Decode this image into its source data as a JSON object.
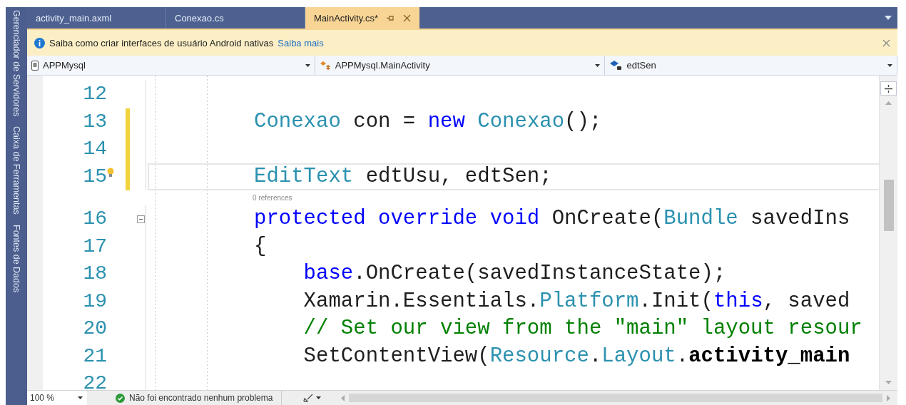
{
  "side_panels": [
    {
      "label": "Gerenciador de Servidores"
    },
    {
      "label": "Caixa de Ferramentas"
    },
    {
      "label": "Fontes de Dados"
    }
  ],
  "tabs": [
    {
      "label": "activity_main.axml",
      "selected": false
    },
    {
      "label": "Conexao.cs",
      "selected": false
    },
    {
      "label": "MainActivity.cs*",
      "selected": true
    }
  ],
  "info_bar": {
    "message": "Saiba como criar interfaces de usuário Android nativas",
    "link": "Saiba mais"
  },
  "nav_bar": {
    "project": "APPMysql",
    "class": "APPMysql.MainActivity",
    "member": "edtSen"
  },
  "editor": {
    "lines": [
      {
        "number": "12",
        "changed": false,
        "current": false,
        "lightbulb": false,
        "foldable": false
      },
      {
        "number": "13",
        "changed": true,
        "current": false,
        "lightbulb": false,
        "foldable": false,
        "tokens": [
          {
            "text": "Conexao",
            "kind": "type"
          },
          {
            "text": " con = ",
            "kind": "plain"
          },
          {
            "text": "new",
            "kind": "keyword"
          },
          {
            "text": " Conexao",
            "kind": "type"
          },
          {
            "text": "();",
            "kind": "plain"
          }
        ]
      },
      {
        "number": "14",
        "changed": true,
        "current": false,
        "lightbulb": false,
        "foldable": false
      },
      {
        "number": "15",
        "changed": true,
        "current": true,
        "lightbulb": true,
        "foldable": false,
        "tokens": [
          {
            "text": "EditText",
            "kind": "type"
          },
          {
            "text": " edtUsu, edtSen;",
            "kind": "plain"
          }
        ]
      },
      {
        "number": "16",
        "changed": false,
        "current": false,
        "lightbulb": false,
        "foldable": true,
        "codelens": "0 references",
        "tokens": [
          {
            "text": "protected override void",
            "kind": "keyword"
          },
          {
            "text": " OnCreate(",
            "kind": "plain"
          },
          {
            "text": "Bundle",
            "kind": "type"
          },
          {
            "text": " savedIns",
            "kind": "plain"
          }
        ]
      },
      {
        "number": "17",
        "changed": false,
        "current": false,
        "lightbulb": false,
        "foldable": false,
        "tokens": [
          {
            "text": "{",
            "kind": "plain"
          }
        ]
      },
      {
        "number": "18",
        "changed": false,
        "current": false,
        "lightbulb": false,
        "foldable": false,
        "tokens": [
          {
            "text": "    base",
            "kind": "keyword"
          },
          {
            "text": ".OnCreate(savedInstanceState);",
            "kind": "plain"
          }
        ]
      },
      {
        "number": "19",
        "changed": false,
        "current": false,
        "lightbulb": false,
        "foldable": false,
        "tokens": [
          {
            "text": "    Xamarin.Essentials.",
            "kind": "plain"
          },
          {
            "text": "Platform",
            "kind": "type"
          },
          {
            "text": ".Init(",
            "kind": "plain"
          },
          {
            "text": "this",
            "kind": "keyword"
          },
          {
            "text": ", saved",
            "kind": "plain"
          }
        ]
      },
      {
        "number": "20",
        "changed": false,
        "current": false,
        "lightbulb": false,
        "foldable": false,
        "tokens": [
          {
            "text": "    // Set our view from the \"main\" layout resour",
            "kind": "comment"
          }
        ]
      },
      {
        "number": "21",
        "changed": false,
        "current": false,
        "lightbulb": false,
        "foldable": false,
        "tokens": [
          {
            "text": "    SetContentView(",
            "kind": "plain"
          },
          {
            "text": "Resource",
            "kind": "type"
          },
          {
            "text": ".",
            "kind": "plain"
          },
          {
            "text": "Layout",
            "kind": "type"
          },
          {
            "text": ".",
            "kind": "plain"
          },
          {
            "text": "activity_main",
            "kind": "bold"
          }
        ]
      },
      {
        "number": "22",
        "changed": false,
        "current": false,
        "lightbulb": false,
        "foldable": false
      }
    ]
  },
  "status_bar": {
    "zoom": "100 %",
    "message": "Não foi encontrado nenhum problema"
  }
}
